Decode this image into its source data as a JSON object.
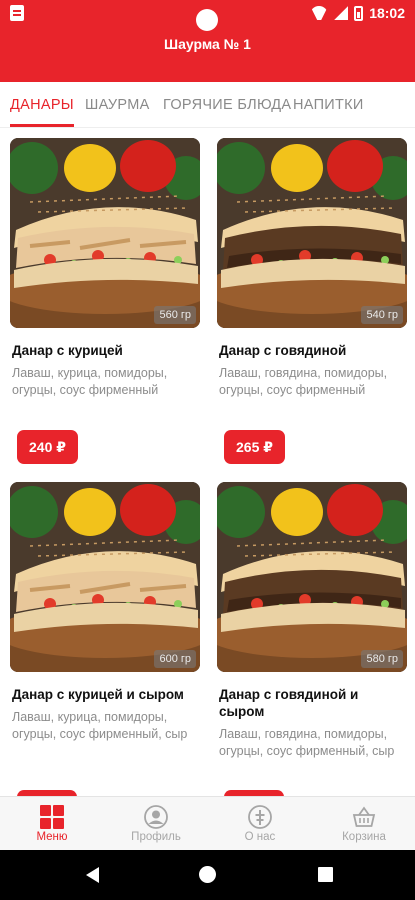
{
  "status_bar": {
    "time": "18:02"
  },
  "app": {
    "title": "Шаурма № 1"
  },
  "tabs": [
    {
      "label": "ДАНАРЫ",
      "active": true
    },
    {
      "label": "ШАУРМА",
      "active": false
    },
    {
      "label": "ГОРЯЧИЕ БЛЮДА",
      "active": false
    },
    {
      "label": "НАПИТКИ",
      "active": false
    }
  ],
  "products": [
    {
      "name": "Данар с курицей",
      "description": "Лаваш, курица, помидоры, огурцы, соус фирменный",
      "weight": "560 гр",
      "price": "240 ₽",
      "filling": "chicken"
    },
    {
      "name": "Данар с говядиной",
      "description": "Лаваш, говядина, помидоры, огурцы, соус фирменный",
      "weight": "540 гр",
      "price": "265 ₽",
      "filling": "beef"
    },
    {
      "name": "Данар с курицей и сыром",
      "description": "Лаваш, курица, помидоры, огурцы, соус фирменный, сыр",
      "weight": "600 гр",
      "price": "",
      "filling": "chicken"
    },
    {
      "name": "Данар с говядиной и сыром",
      "description": "Лаваш, говядина, помидоры, огурцы, соус фирменный, сыр",
      "weight": "580 гр",
      "price": "",
      "filling": "beef"
    }
  ],
  "bottom_nav": [
    {
      "label": "Меню",
      "icon": "menu-grid-icon",
      "active": true
    },
    {
      "label": "Профиль",
      "icon": "profile-icon",
      "active": false
    },
    {
      "label": "О нас",
      "icon": "info-icon",
      "active": false
    },
    {
      "label": "Корзина",
      "icon": "basket-icon",
      "active": false
    }
  ],
  "colors": {
    "accent": "#e8242b",
    "inactive": "#a6a6a6",
    "muted_text": "#8c8c8c"
  }
}
